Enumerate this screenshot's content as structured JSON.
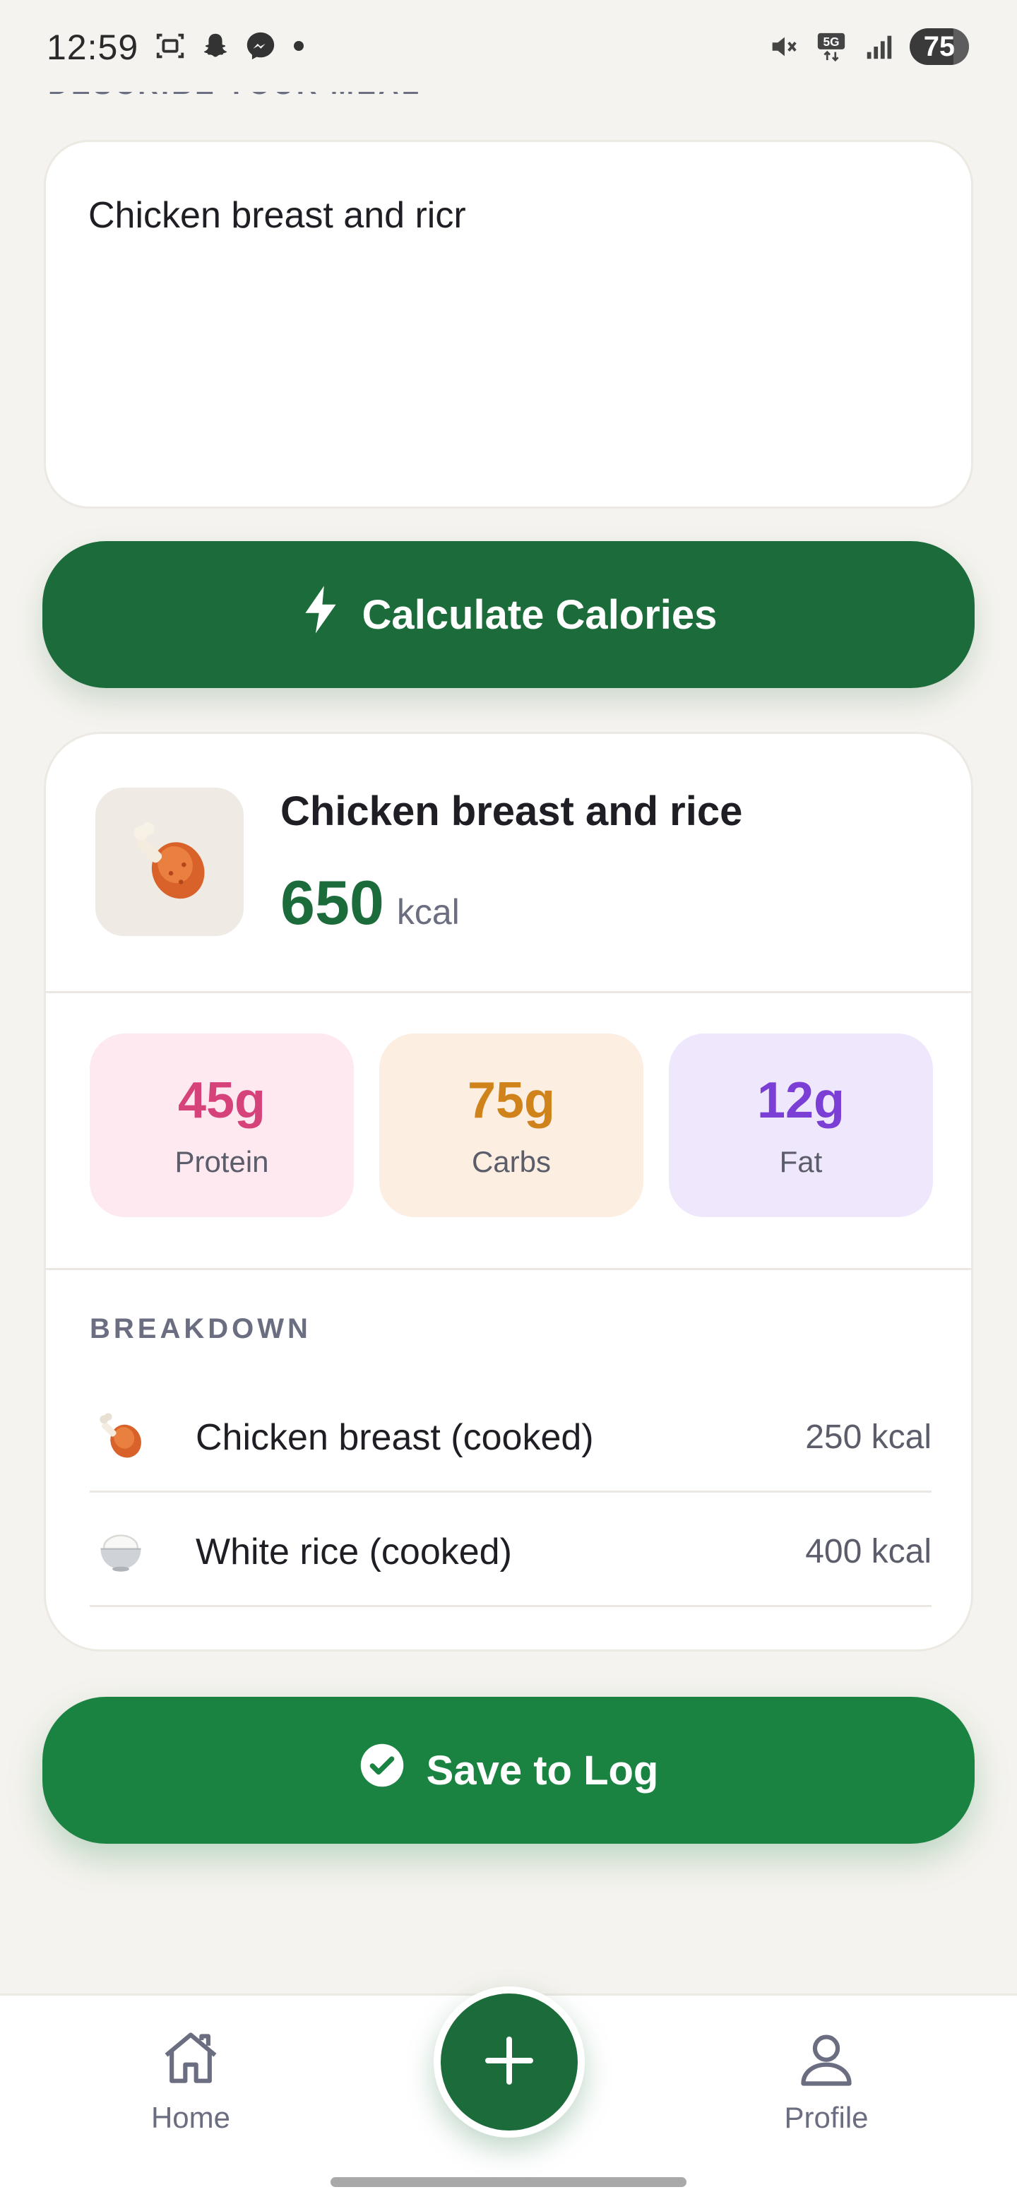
{
  "status_bar": {
    "time": "12:59",
    "battery": "75",
    "left_icons": [
      "screenshot-icon",
      "snapchat-icon",
      "messenger-icon",
      "dot-icon"
    ],
    "right_icons": [
      "mute-icon",
      "5g-icon",
      "signal-icon",
      "battery-icon"
    ],
    "network": "5G"
  },
  "section_label": "DESCRIBE YOUR MEAL",
  "meal_input": {
    "value": "Chicken breast and ricr"
  },
  "calculate_button": {
    "label": "Calculate Calories",
    "icon": "lightning-icon"
  },
  "result": {
    "food_name": "Chicken breast and rice",
    "food_emoji": "🍗",
    "calories": "650",
    "calories_unit": "kcal",
    "macros": [
      {
        "value": "45g",
        "label": "Protein",
        "color": "#d6437a"
      },
      {
        "value": "75g",
        "label": "Carbs",
        "color": "#d0831b"
      },
      {
        "value": "12g",
        "label": "Fat",
        "color": "#7b3fd6"
      }
    ],
    "breakdown_label": "BREAKDOWN",
    "breakdown": [
      {
        "icon": "drumstick-icon",
        "name": "Chicken breast (cooked)",
        "kcal": "250 kcal"
      },
      {
        "icon": "rice-bowl-icon",
        "name": "White rice (cooked)",
        "kcal": "400 kcal"
      }
    ]
  },
  "save_button": {
    "label": "Save to Log",
    "icon": "check-circle-icon"
  },
  "nav": {
    "home_label": "Home",
    "profile_label": "Profile",
    "add_icon": "plus-icon"
  },
  "colors": {
    "primary": "#1c6b3a",
    "save": "#1b8341",
    "background": "#f5f3ef"
  }
}
